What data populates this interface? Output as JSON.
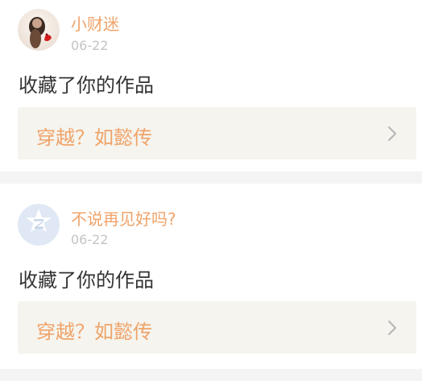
{
  "feed": {
    "items": [
      {
        "username": "小财迷",
        "date": "06-22",
        "action": "收藏了你的作品",
        "work_title": "穿越？如懿传",
        "avatar_icon": "user-photo-avatar",
        "chevron_icon": "chevron-right-icon"
      },
      {
        "username": "不说再见好吗?",
        "date": "06-22",
        "action": "收藏了你的作品",
        "work_title": "穿越？如懿传",
        "avatar_icon": "default-avatar-icon",
        "chevron_icon": "chevron-right-icon"
      }
    ]
  },
  "colors": {
    "username": "#f0a36a",
    "date": "#c4c4c4",
    "action_text": "#333333",
    "link_bg": "#f5f4ee",
    "separator": "#f4f4f4",
    "default_avatar": "#dfe8f4"
  }
}
